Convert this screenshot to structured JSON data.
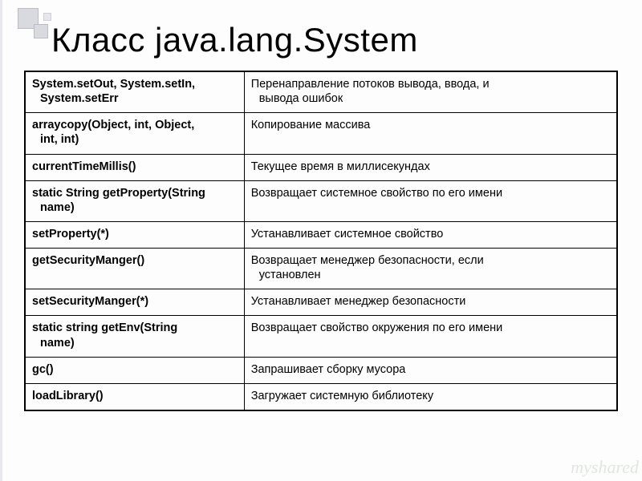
{
  "title": "Класс java.lang.System",
  "watermark": "myshared",
  "table": {
    "rows": [
      {
        "method_l1": "System.setOut, System.setIn,",
        "method_l2": "System.setErr",
        "desc_l1": "Перенаправление потоков вывода, ввода, и",
        "desc_l2": "вывода ошибок"
      },
      {
        "method_l1": "arraycopy(Object, int, Object,",
        "method_l2": "int, int)",
        "desc_l1": "Копирование массива",
        "desc_l2": ""
      },
      {
        "method_l1": "currentTimeMillis()",
        "method_l2": "",
        "desc_l1": "Текущее время в миллисекундах",
        "desc_l2": ""
      },
      {
        "method_l1": "static String getProperty(String",
        "method_l2": "name)",
        "desc_l1": "Возвращает системное свойство по его имени",
        "desc_l2": ""
      },
      {
        "method_l1": "setProperty(*)",
        "method_l2": "",
        "desc_l1": "Устанавливает системное свойство",
        "desc_l2": ""
      },
      {
        "method_l1": "getSecurityManger()",
        "method_l2": "",
        "desc_l1": "Возвращает менеджер безопасности, если",
        "desc_l2": "установлен"
      },
      {
        "method_l1": "setSecurityManger(*)",
        "method_l2": "",
        "desc_l1": "Устанавливает менеджер безопасности",
        "desc_l2": ""
      },
      {
        "method_l1": "static string getEnv(String",
        "method_l2": "name)",
        "desc_l1": "Возвращает свойство окружения по его имени",
        "desc_l2": ""
      },
      {
        "method_l1": "gc()",
        "method_l2": "",
        "desc_l1": "Запрашивает сборку мусора",
        "desc_l2": ""
      },
      {
        "method_l1": "loadLibrary()",
        "method_l2": "",
        "desc_l1": "Загружает системную библиотеку",
        "desc_l2": ""
      }
    ]
  }
}
